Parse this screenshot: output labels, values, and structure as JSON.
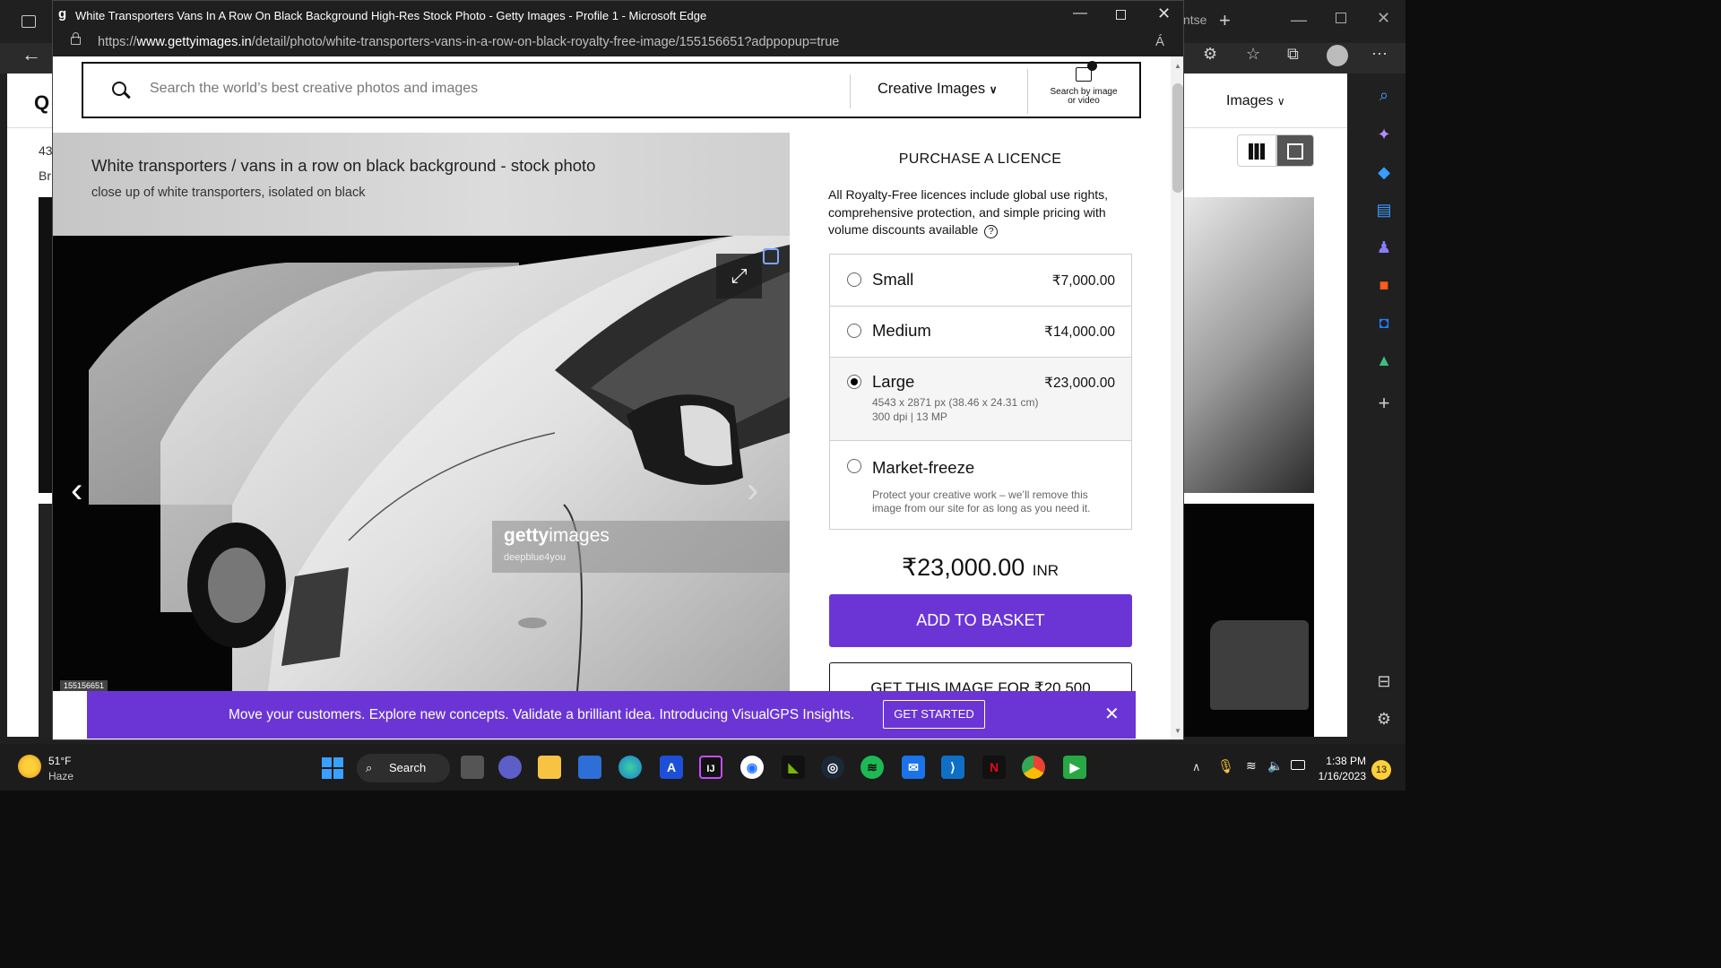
{
  "background_window": {
    "tab_partial_text": "ntse",
    "left_text_1": "43",
    "left_text_2": "Br",
    "filter_label": "Images",
    "chevron": "⌄"
  },
  "popup": {
    "window_title": "White Transporters Vans In A Row On Black Background High-Res Stock Photo - Getty Images - Profile 1 - Microsoft Edge",
    "url_prefix": "https://",
    "url_domain": "www.gettyimages.in",
    "url_path": "/detail/photo/white-transporters-vans-in-a-row-on-black-royalty-free-image/155156651?adppopup=true",
    "read_aloud": "Á"
  },
  "search": {
    "placeholder": "Search the world’s best creative photos and images",
    "category_label": "Creative Images",
    "by_image_label_1": "Search by image",
    "by_image_label_2": "or video"
  },
  "image": {
    "title": "White transporters / vans in a row on black background - stock photo",
    "caption": "close up of white transporters, isolated on black",
    "watermark_brand": "gettyimages",
    "watermark_bold": "getty",
    "watermark_light": "images",
    "watermark_credit": "deepblue4you",
    "image_id": "155156651"
  },
  "purchase": {
    "heading": "PURCHASE A LICENCE",
    "description": "All Royalty-Free licences include global use rights, comprehensive protection, and simple pricing with volume discounts available",
    "help_icon": "?",
    "options": [
      {
        "name": "Small",
        "price": "₹7,000.00",
        "selected": false
      },
      {
        "name": "Medium",
        "price": "₹14,000.00",
        "selected": false
      },
      {
        "name": "Large",
        "price": "₹23,000.00",
        "selected": true,
        "detail_1": "4543 x 2871 px (38.46 x 24.31 cm)",
        "detail_2": "300 dpi | 13 MP"
      },
      {
        "name": "Market-freeze",
        "price": "",
        "selected": false,
        "detail_1": "Protect your creative work – we’ll remove this",
        "detail_2": "image from our site for as long as you need it."
      }
    ],
    "total_price": "₹23,000.00",
    "currency": "INR",
    "add_to_basket": "ADD TO BASKET",
    "get_image_partial": "GET THIS IMAGE FOR ₹20,500"
  },
  "banner": {
    "text": "Move your customers. Explore new concepts. Validate a brilliant idea. Introducing VisualGPS Insights.",
    "cta": "GET STARTED",
    "close": "✕"
  },
  "taskbar": {
    "weather_temp": "51°F",
    "weather_desc": "Haze",
    "search_label": "Search",
    "time": "1:38 PM",
    "date": "1/16/2023",
    "notification_count": "13"
  },
  "colors": {
    "accent": "#6b35d6",
    "banner": "#6b35d6",
    "chrome_dark": "#1f1f1f"
  }
}
